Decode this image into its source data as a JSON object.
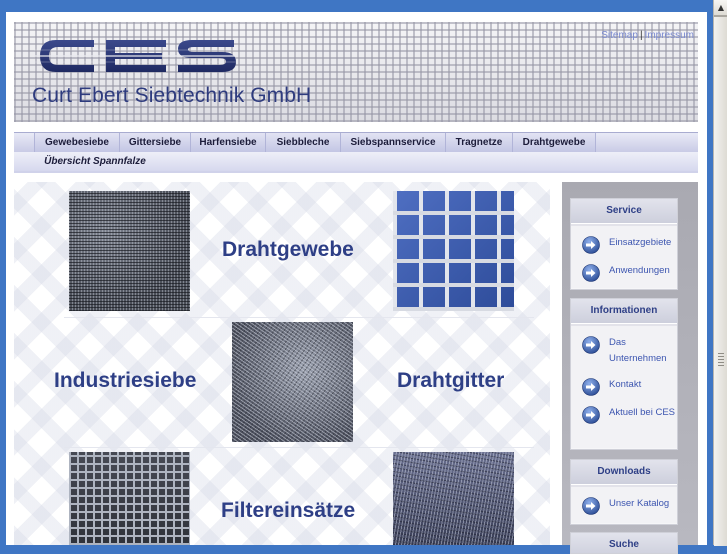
{
  "header": {
    "logo_text": "CES",
    "company_name": "Curt Ebert Siebtechnik GmbH",
    "links": [
      "Sitemap",
      "Impressum"
    ],
    "separator": "|"
  },
  "nav": {
    "items": [
      "Gewebesiebe",
      "Gittersiebe",
      "Harfensiebe",
      "Siebbleche",
      "Siebspannservice",
      "Tragnetze",
      "Drahtgewebe"
    ],
    "second_row": "Übersicht Spannfalze"
  },
  "main": {
    "labels": {
      "drahtgewebe": "Drahtgewebe",
      "industriesiebe": "Industriesiebe",
      "drahtgitter": "Drahtgitter",
      "filtereinsaetze": "Filtereinsätze"
    }
  },
  "sidebar": {
    "boxes": [
      {
        "title": "Service",
        "links": [
          "Einsatzgebiete",
          "Anwendungen"
        ]
      },
      {
        "title": "Informationen",
        "links": [
          "Das Unternehmen",
          "Kontakt",
          "Aktuell bei CES"
        ]
      },
      {
        "title": "Downloads",
        "links": [
          "Unser Katalog"
        ]
      },
      {
        "title": "Suche",
        "links": []
      }
    ]
  },
  "colors": {
    "page_background": "#3f76c4",
    "accent_text": "#2e3f86",
    "link": "#3d56b0"
  },
  "icons": [
    "arrow-right-circle-icon",
    "scroll-up-arrow-icon"
  ]
}
